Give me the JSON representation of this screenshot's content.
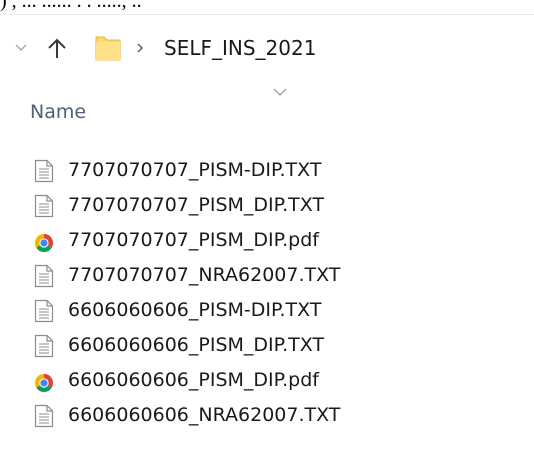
{
  "top_edge_text": ") , ... ...... . . ....., ..",
  "address_bar": {
    "path": [
      "SELF_INS_2021"
    ],
    "icons": {
      "recent": "chevron-down-icon",
      "up": "up-arrow-icon",
      "folder": "folder-icon",
      "separator": "chevron-right-icon"
    }
  },
  "columns": {
    "name_label": "Name",
    "sort_indicator": "chevron-down-icon"
  },
  "files": [
    {
      "name": "7707070707_PISM-DIP.TXT",
      "type": "text",
      "icon": "text-document-icon"
    },
    {
      "name": "7707070707_PISM_DIP.TXT",
      "type": "text",
      "icon": "text-document-icon"
    },
    {
      "name": "7707070707_PISM_DIP.pdf",
      "type": "pdf",
      "icon": "chrome-icon"
    },
    {
      "name": "7707070707_NRA62007.TXT",
      "type": "text",
      "icon": "text-document-icon"
    },
    {
      "name": "6606060606_PISM-DIP.TXT",
      "type": "text",
      "icon": "text-document-icon"
    },
    {
      "name": "6606060606_PISM_DIP.TXT",
      "type": "text",
      "icon": "text-document-icon"
    },
    {
      "name": "6606060606_PISM_DIP.pdf",
      "type": "pdf",
      "icon": "chrome-icon"
    },
    {
      "name": "6606060606_NRA62007.TXT",
      "type": "text",
      "icon": "text-document-icon"
    }
  ],
  "colors": {
    "header_text": "#4c607a",
    "folder_yellow": "#ffd866",
    "chrome_red": "#db4437",
    "chrome_green": "#0f9d58",
    "chrome_yellow": "#f4b400",
    "chrome_blue": "#4285f4"
  }
}
